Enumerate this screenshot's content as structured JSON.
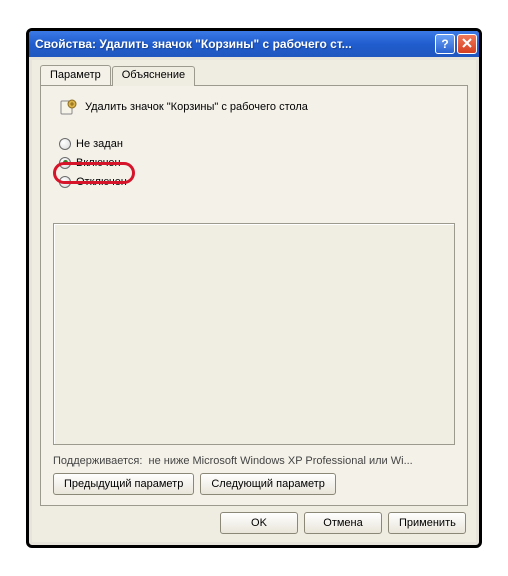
{
  "window": {
    "title": "Свойства: Удалить значок \"Корзины\" с рабочего ст..."
  },
  "tabs": {
    "param": "Параметр",
    "explain": "Объяснение"
  },
  "policy": {
    "name": "Удалить значок \"Корзины\" с рабочего стола"
  },
  "radios": {
    "not_set": "Не задан",
    "enabled": "Включен",
    "disabled": "Отключен"
  },
  "supported": {
    "label": "Поддерживается:",
    "value": "не ниже Microsoft Windows XP Professional или Wi..."
  },
  "nav": {
    "prev": "Предыдущий параметр",
    "next": "Следующий параметр"
  },
  "buttons": {
    "ok": "OK",
    "cancel": "Отмена",
    "apply": "Применить"
  }
}
